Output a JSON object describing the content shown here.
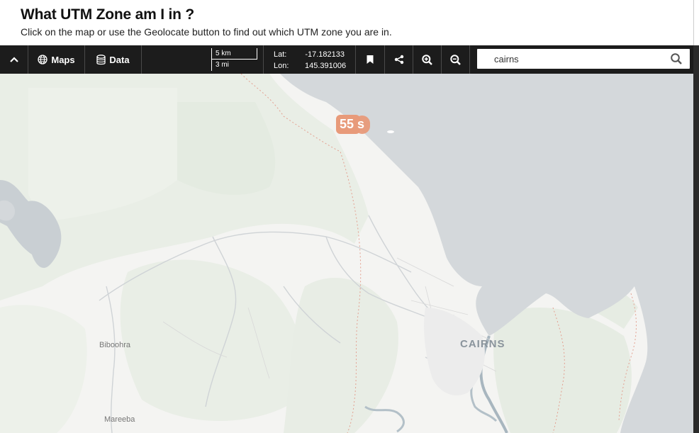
{
  "header": {
    "title": "What UTM Zone am I in ?",
    "subtitle": "Click on the map or use the Geolocate button to find out which UTM zone you are in."
  },
  "toolbar": {
    "collapse_icon": "chevron-up-icon",
    "maps_label": "Maps",
    "maps_icon": "globe-icon",
    "data_label": "Data",
    "data_icon": "database-icon",
    "scale": {
      "metric": "5 km",
      "imperial": "3 mi"
    },
    "coords": {
      "lat_label": "Lat:",
      "lat_value": "-17.182133",
      "lon_label": "Lon:",
      "lon_value": "145.391006"
    },
    "bookmark_icon": "bookmark-icon",
    "share_icon": "share-icon",
    "zoom_in_icon": "zoom-in-icon",
    "zoom_out_icon": "zoom-out-icon",
    "search": {
      "value": "cairns",
      "placeholder": "",
      "icon": "search-icon"
    }
  },
  "map": {
    "utm_zone_label": "55 s",
    "places": {
      "cairns": "CAIRNS",
      "biboohra": "Biboohra",
      "mareeba": "Mareeba"
    },
    "colors": {
      "land": "#f4f4f2",
      "forest": "#e6ece3",
      "water": "#d4d8db",
      "zone_badge": "#e89a7a",
      "boundary": "#e3a090"
    }
  }
}
